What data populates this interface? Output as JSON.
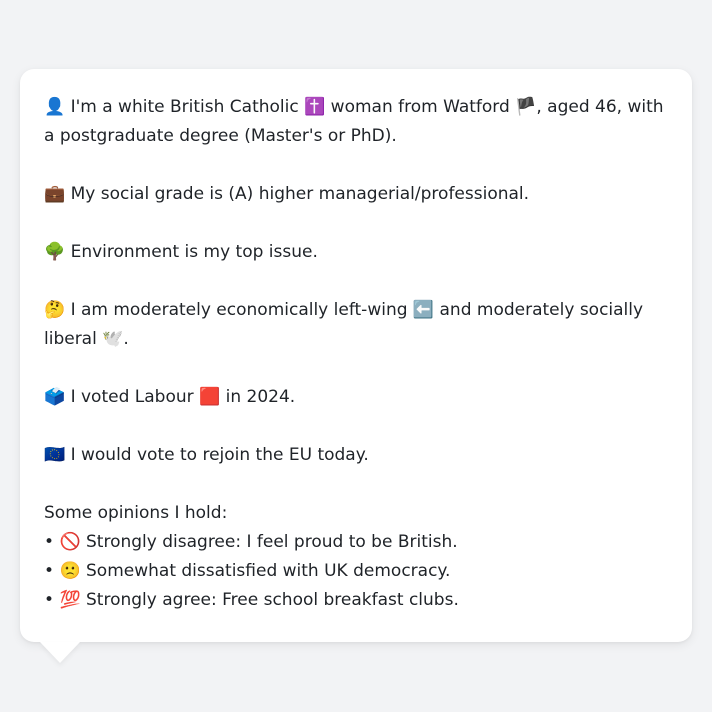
{
  "bubble": {
    "identity": {
      "icon": "👤",
      "text_before_faith": "I'm a white British Catholic ",
      "faith_icon": "✝️",
      "text_before_flag": " woman from Watford ",
      "flag_icon": "🏴",
      "text_after_flag": ", aged 46, with a postgraduate degree (Master's or PhD)."
    },
    "social_grade": {
      "icon": "💼",
      "text": "My social grade is (A) higher managerial/professional."
    },
    "top_issue": {
      "icon": "🌳",
      "text": "Environment is my top issue."
    },
    "ideology": {
      "icon": "🤔",
      "text_before_arrow": "I am moderately economically left-wing ",
      "arrow_icon": "⬅️",
      "text_after_arrow": " and moderately socially liberal ",
      "dove_icon": "🕊️",
      "text_end": "."
    },
    "vote_2024": {
      "icon": "🗳️",
      "text_before_party": "I voted Labour ",
      "party_icon": "🟥",
      "text_after_party": " in 2024."
    },
    "eu": {
      "icon": "🇪🇺",
      "text": "I would vote to rejoin the EU today."
    },
    "opinions": {
      "heading": "Some opinions I hold:",
      "items": [
        {
          "bullet": "•",
          "icon": "🚫",
          "text": "Strongly disagree: I feel proud to be British."
        },
        {
          "bullet": "•",
          "icon": "🙁",
          "text": "Somewhat dissatisfied with UK democracy."
        },
        {
          "bullet": "•",
          "icon": "💯",
          "text": "Strongly agree: Free school breakfast clubs."
        }
      ]
    }
  },
  "colors": {
    "page_background": "#f2f3f5",
    "bubble_background": "#ffffff",
    "text": "#1f2328"
  }
}
